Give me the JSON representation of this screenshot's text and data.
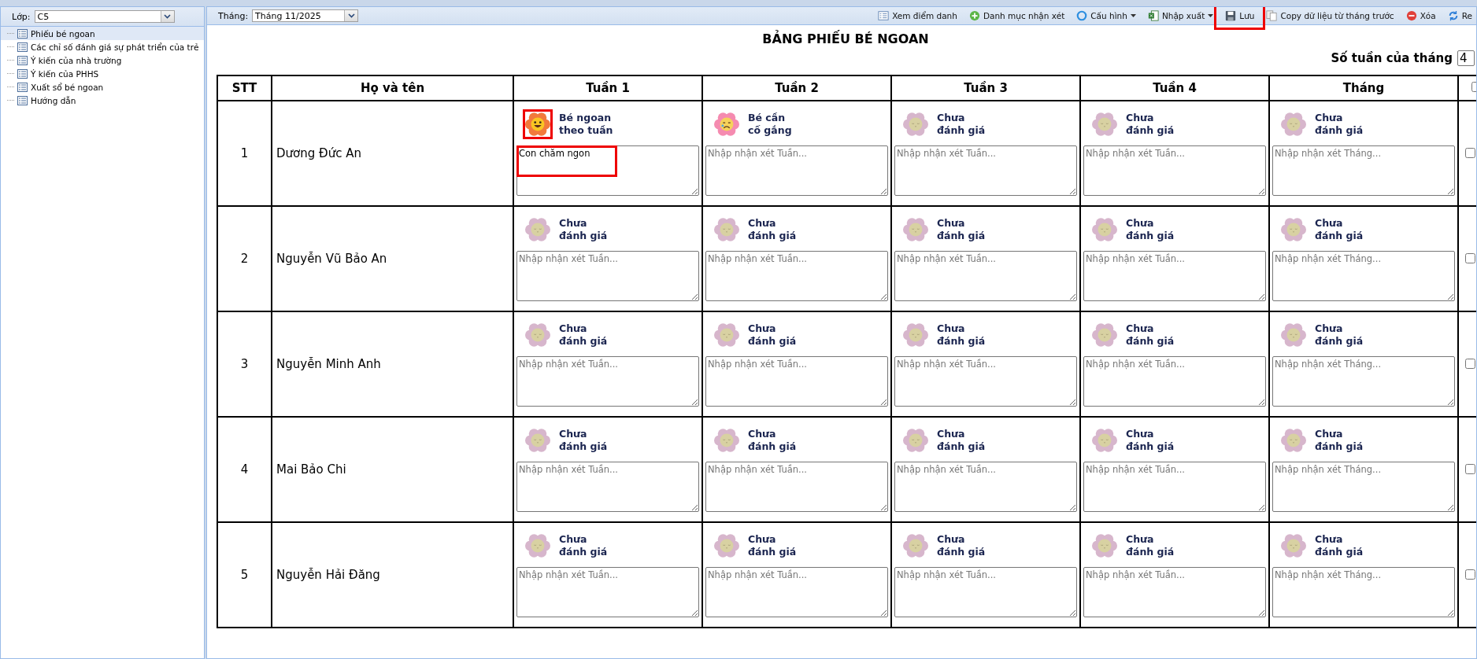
{
  "sidebar": {
    "class_label": "Lớp:",
    "class_value": "C5",
    "items": [
      {
        "label": "Phiếu bé ngoan",
        "selected": true
      },
      {
        "label": "Các chỉ số đánh giá sự phát triển của trẻ",
        "selected": false
      },
      {
        "label": "Ý kiến của nhà trường",
        "selected": false
      },
      {
        "label": "Ý kiến của PHHS",
        "selected": false
      },
      {
        "label": "Xuất sổ bé ngoan",
        "selected": false
      },
      {
        "label": "Hướng dẫn",
        "selected": false
      }
    ]
  },
  "toolbar": {
    "month_label": "Tháng:",
    "month_value": "Tháng 11/2025",
    "actions": [
      {
        "label": "Xem điểm danh",
        "kind": "list",
        "dropdown": false
      },
      {
        "label": "Danh mục nhận xét",
        "kind": "add",
        "dropdown": false
      },
      {
        "label": "Cấu hình",
        "kind": "config",
        "dropdown": true
      },
      {
        "label": "Nhập xuất",
        "kind": "excel",
        "dropdown": true
      },
      {
        "label": "Lưu",
        "kind": "save",
        "dropdown": false,
        "highlighted": true
      },
      {
        "label": "Copy dữ liệu từ tháng trước",
        "kind": "copy",
        "dropdown": false
      },
      {
        "label": "Xóa",
        "kind": "delete",
        "dropdown": false
      },
      {
        "label": "Re",
        "kind": "refresh",
        "dropdown": false
      }
    ]
  },
  "title": "BẢNG PHIẾU BÉ NGOAN",
  "weeks_label": "Số tuần của tháng",
  "weeks_value": "4",
  "table": {
    "columns": [
      "STT",
      "Họ và tên",
      "Tuần 1",
      "Tuần 2",
      "Tuần 3",
      "Tuần 4",
      "Tháng"
    ],
    "select_all_checked": false,
    "rows": [
      {
        "cells": [
          "1",
          "Dương Đức An",
          {
            "kind": "good",
            "label": "Bé ngoan\ntheo tuần",
            "comment": "Con chăm ngon",
            "icon_highlighted": true,
            "comment_highlighted": true
          },
          {
            "kind": "try",
            "label": "Bé cần\ncố gắng",
            "placeholder": "Nhập nhận xét Tuần..."
          },
          {
            "kind": "none",
            "label": "Chưa\nđánh giá",
            "placeholder": "Nhập nhận xét Tuần..."
          },
          {
            "kind": "none",
            "label": "Chưa\nđánh giá",
            "placeholder": "Nhập nhận xét Tuần..."
          },
          {
            "kind": "none",
            "label": "Chưa\nđánh giá",
            "placeholder": "Nhập nhận xét Tháng..."
          }
        ],
        "checked": false
      },
      {
        "cells": [
          "2",
          "Nguyễn Vũ Bảo An",
          {
            "kind": "none",
            "label": "Chưa\nđánh giá",
            "placeholder": "Nhập nhận xét Tuần..."
          },
          {
            "kind": "none",
            "label": "Chưa\nđánh giá",
            "placeholder": "Nhập nhận xét Tuần..."
          },
          {
            "kind": "none",
            "label": "Chưa\nđánh giá",
            "placeholder": "Nhập nhận xét Tuần..."
          },
          {
            "kind": "none",
            "label": "Chưa\nđánh giá",
            "placeholder": "Nhập nhận xét Tuần..."
          },
          {
            "kind": "none",
            "label": "Chưa\nđánh giá",
            "placeholder": "Nhập nhận xét Tháng..."
          }
        ],
        "checked": false
      },
      {
        "cells": [
          "3",
          "Nguyễn Minh Anh",
          {
            "kind": "none",
            "label": "Chưa\nđánh giá",
            "placeholder": "Nhập nhận xét Tuần..."
          },
          {
            "kind": "none",
            "label": "Chưa\nđánh giá",
            "placeholder": "Nhập nhận xét Tuần..."
          },
          {
            "kind": "none",
            "label": "Chưa\nđánh giá",
            "placeholder": "Nhập nhận xét Tuần..."
          },
          {
            "kind": "none",
            "label": "Chưa\nđánh giá",
            "placeholder": "Nhập nhận xét Tuần..."
          },
          {
            "kind": "none",
            "label": "Chưa\nđánh giá",
            "placeholder": "Nhập nhận xét Tháng..."
          }
        ],
        "checked": false
      },
      {
        "cells": [
          "4",
          "Mai Bảo Chi",
          {
            "kind": "none",
            "label": "Chưa\nđánh giá",
            "placeholder": "Nhập nhận xét Tuần..."
          },
          {
            "kind": "none",
            "label": "Chưa\nđánh giá",
            "placeholder": "Nhập nhận xét Tuần..."
          },
          {
            "kind": "none",
            "label": "Chưa\nđánh giá",
            "placeholder": "Nhập nhận xét Tuần..."
          },
          {
            "kind": "none",
            "label": "Chưa\nđánh giá",
            "placeholder": "Nhập nhận xét Tuần..."
          },
          {
            "kind": "none",
            "label": "Chưa\nđánh giá",
            "placeholder": "Nhập nhận xét Tháng..."
          }
        ],
        "checked": false
      },
      {
        "cells": [
          "5",
          "Nguyễn Hải Đăng",
          {
            "kind": "none",
            "label": "Chưa\nđánh giá",
            "placeholder": "Nhập nhận xét Tuần..."
          },
          {
            "kind": "none",
            "label": "Chưa\nđánh giá",
            "placeholder": "Nhập nhận xét Tuần..."
          },
          {
            "kind": "none",
            "label": "Chưa\nđánh giá",
            "placeholder": "Nhập nhận xét Tuần..."
          },
          {
            "kind": "none",
            "label": "Chưa\nđánh giá",
            "placeholder": "Nhập nhận xét Tuần..."
          },
          {
            "kind": "none",
            "label": "Chưa\nđánh giá",
            "placeholder": "Nhập nhận xét Tháng..."
          }
        ],
        "checked": false
      }
    ]
  }
}
